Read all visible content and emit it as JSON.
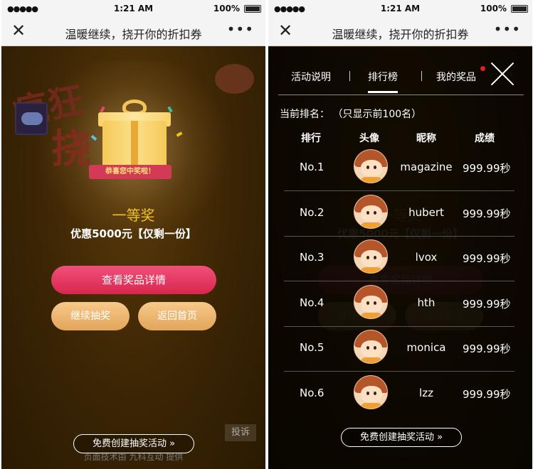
{
  "status_bar": {
    "signal": "●●●●●",
    "time": "1:21 AM",
    "battery": "100%"
  },
  "nav": {
    "close_icon": "close-icon",
    "title": "温暖继续，挠开你的折扣券",
    "more": "•••"
  },
  "result": {
    "banner": "恭喜您中奖啦！",
    "prize_name": "一等奖",
    "prize_desc": "优惠5000元【仅剩一份】",
    "view_details": "查看奖品详情",
    "continue": "继续抽奖",
    "back_home": "返回首页",
    "free_create": "免费创建抽奖活动 »",
    "complain": "投诉",
    "footer": "页面技术由 九科互动 提供"
  },
  "leaderboard": {
    "tabs": [
      {
        "label": "活动说明",
        "active": false
      },
      {
        "label": "排行榜",
        "active": true
      },
      {
        "label": "我的奖品",
        "active": false
      }
    ],
    "rank_info": "当前排名：   （只显示前100名）",
    "headers": {
      "rank": "排行",
      "avatar": "头像",
      "nickname": "昵称",
      "score": "成绩"
    },
    "rows": [
      {
        "rank": "No.1",
        "nickname": "magazine",
        "score": "999.99秒"
      },
      {
        "rank": "No.2",
        "nickname": "hubert",
        "score": "999.99秒"
      },
      {
        "rank": "No.3",
        "nickname": "lvox",
        "score": "999.99秒"
      },
      {
        "rank": "No.4",
        "nickname": "hth",
        "score": "999.99秒"
      },
      {
        "rank": "No.5",
        "nickname": "monica",
        "score": "999.99秒"
      },
      {
        "rank": "No.6",
        "nickname": "lzz",
        "score": "999.99秒"
      }
    ]
  },
  "colors": {
    "prize_gold": "#f0c420",
    "primary_pink": "#e0305a",
    "secondary_orange": "#f0b870",
    "dark_bg": "#3a2404"
  }
}
